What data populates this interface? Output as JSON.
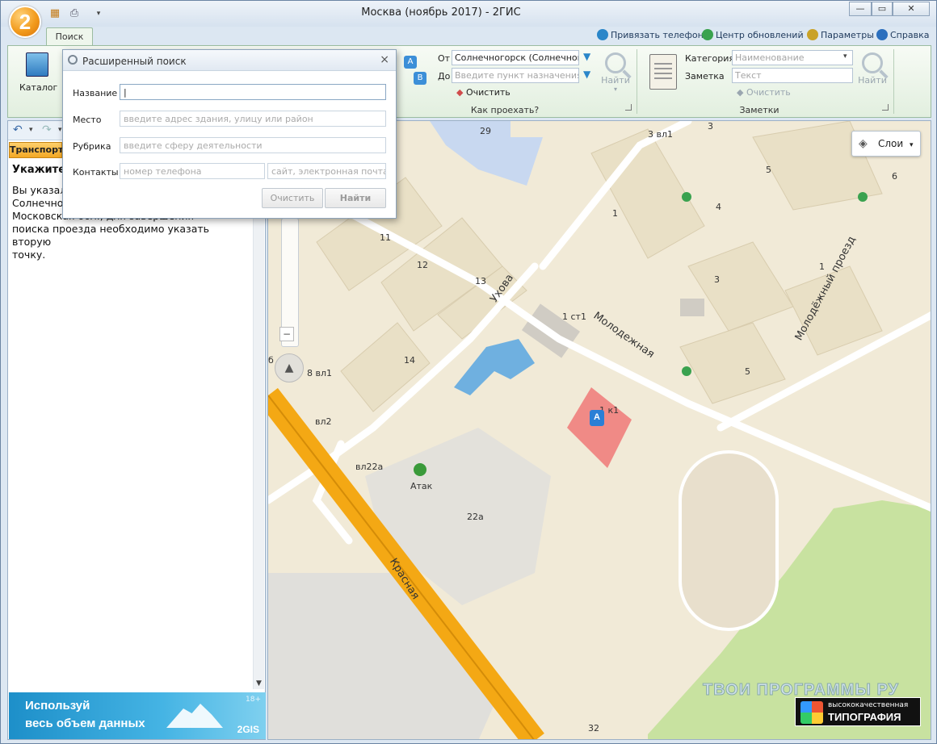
{
  "window": {
    "title": "Москва (ноябрь 2017) - 2ГИС",
    "logo_text": "2",
    "min": "—",
    "max": "▭",
    "close": "✕"
  },
  "ribbon": {
    "tab_search": "Поиск",
    "top_commands": {
      "bind_phone": "Привязать телефон",
      "update_center": "Центр обновлений",
      "params": "Параметры",
      "help": "Справка"
    },
    "catalog": "Каталог",
    "route": {
      "from_label": "От",
      "to_label": "До",
      "from_value": "Солнечногорск (Солнечногор",
      "to_placeholder": "Введите пункт назначения",
      "clear": "Очистить",
      "find": "Найти",
      "group_label": "Как проехать?"
    },
    "notes": {
      "category_label": "Категория",
      "category_placeholder": "Наименование",
      "note_label": "Заметка",
      "note_placeholder": "Текст",
      "clear": "Очистить",
      "find": "Найти",
      "group_label": "Заметки"
    }
  },
  "adv_search": {
    "title": "Расширенный поиск",
    "close": "×",
    "fields": {
      "name_label": "Название",
      "name_value": "|",
      "place_label": "Место",
      "place_placeholder": "введите адрес здания, улицу или район",
      "rubric_label": "Рубрика",
      "rubric_placeholder": "введите сферу деятельности",
      "contacts_label": "Контакты",
      "phone_placeholder": "номер телефона",
      "site_placeholder": "сайт, электронная почта"
    },
    "clear_button": "Очистить",
    "find_button": "Найти"
  },
  "left_panel": {
    "back": "↶",
    "dd": "▾",
    "forward": "↷",
    "transport_tab": "Транспорт",
    "heading": "Укажите второй пункт",
    "text_lines": [
      "Вы указали",
      "Солнечногорск",
      "Московская обл., для завершения",
      "поиска проезда необходимо указать вторую",
      "точку."
    ],
    "banner_line1": "Используй",
    "banner_line2": "весь объем данных",
    "banner_age": "18+",
    "banner_brand": "2GIS"
  },
  "map": {
    "layers_button": "Слои",
    "layers_arrow": "▾",
    "compass": "▲",
    "zoom_minus": "−",
    "streets": {
      "ukhova": "Ухова",
      "molodezhnaya": "Молодежная",
      "molodezhny_proezd": "Молодёжный проезд",
      "krasnaya": "Красная"
    },
    "labels": [
      "29",
      "3 вл1",
      "3",
      "5",
      "6",
      "4",
      "1",
      "11",
      "12",
      "13",
      "14",
      "1 ст1",
      "3",
      "1",
      "5",
      "8 вл1",
      "вл2",
      "вл22а",
      "Атак",
      "22а",
      "1 к1",
      "32",
      "б"
    ],
    "marker_a": "A",
    "watermark": "ТВОИ ПРОГРАММЫ РУ",
    "badge_small": "высококачественная",
    "badge_big": "ТИПОГРАФИЯ"
  }
}
